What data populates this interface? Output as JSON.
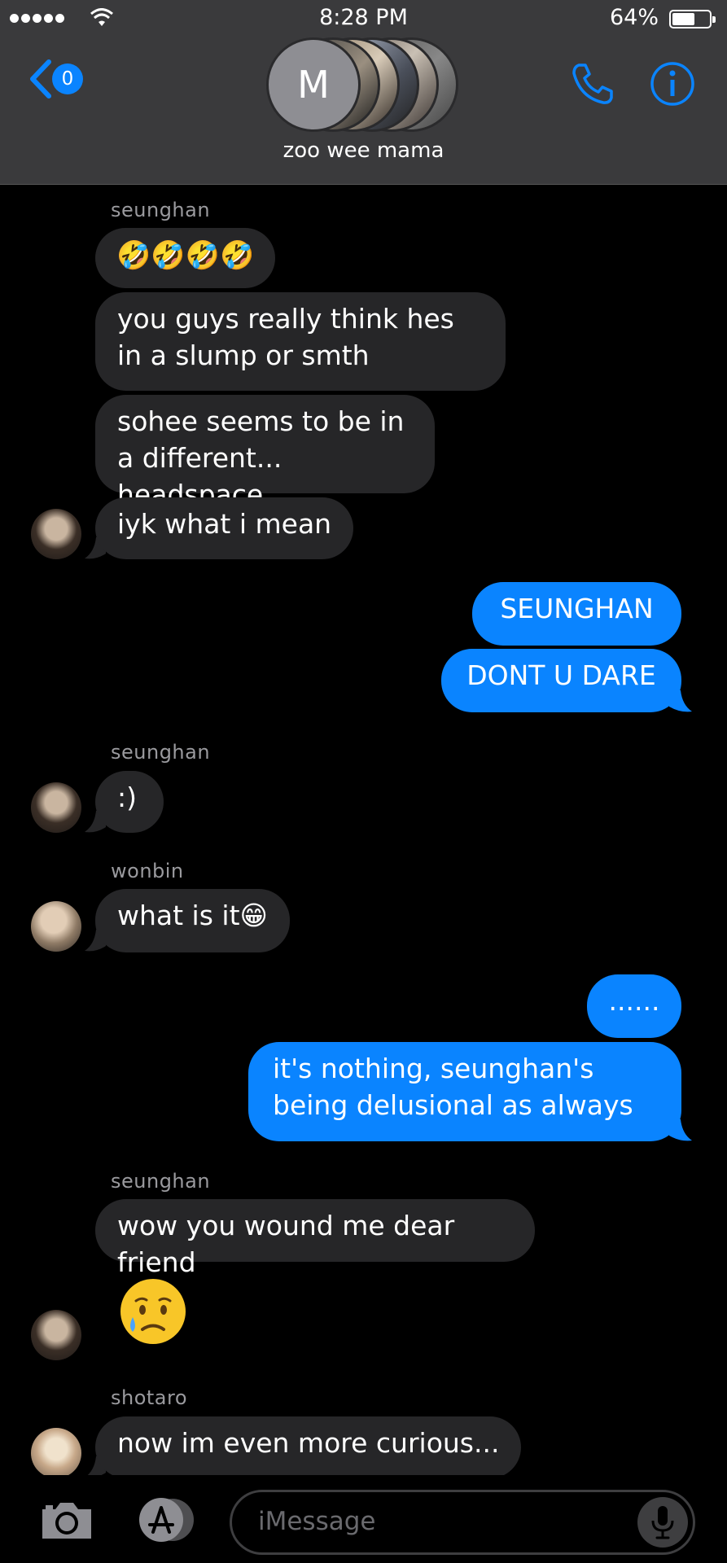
{
  "status_bar": {
    "time": "8:28 PM",
    "battery": "64%",
    "battery_level": 0.64,
    "signal_bars": 5
  },
  "header": {
    "back_badge": "0",
    "group_initial": "M",
    "group_name": "zoo wee mama",
    "icons": [
      "back-chevron-icon",
      "phone-icon",
      "info-icon"
    ]
  },
  "messages": [
    {
      "sender": "seunghan"
    },
    {
      "text": "🤣🤣🤣🤣"
    },
    {
      "text": "you guys really think hes in a slump or smth"
    },
    {
      "text": "sohee seems to be in a different... headspace"
    },
    {
      "text": "iyk what i mean"
    },
    {
      "text": "SEUNGHAN"
    },
    {
      "text": "DONT U DARE"
    },
    {
      "sender": "seunghan"
    },
    {
      "text": ":)"
    },
    {
      "sender": "wonbin"
    },
    {
      "text": "what is it😁"
    },
    {
      "text": "......"
    },
    {
      "text": "it's nothing, seunghan's being delusional as always"
    },
    {
      "sender": "seunghan"
    },
    {
      "text": "wow you wound me dear friend"
    },
    {
      "emoji": "😢"
    },
    {
      "sender": "shotaro"
    },
    {
      "text": "now im even more curious..."
    }
  ],
  "input": {
    "placeholder": "iMessage"
  },
  "colors": {
    "outgoing": "#0a84ff",
    "incoming": "#262628",
    "header": "#3a3a3c"
  }
}
